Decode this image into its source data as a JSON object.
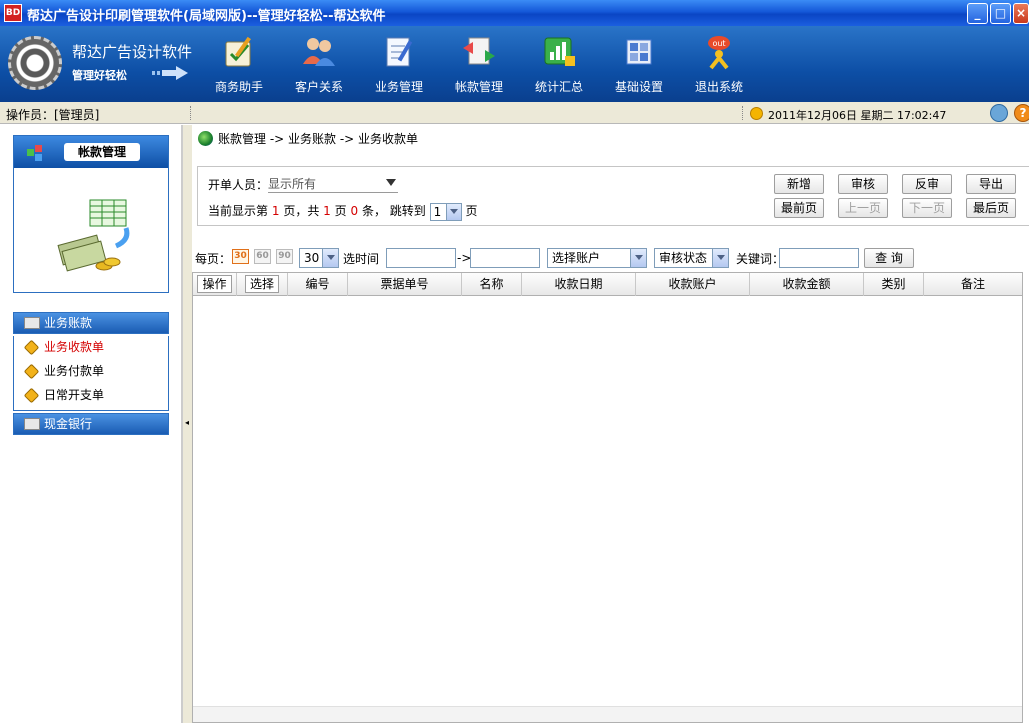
{
  "window": {
    "title": "帮达广告设计印刷管理软件(局域网版)--管理好轻松--帮达软件",
    "icon_label": "BD",
    "minimize_label": "_",
    "maximize_label": "□",
    "close_label": "×"
  },
  "logo": {
    "title": "帮达广告设计软件",
    "subtitle": "管理好轻松"
  },
  "toolbar": [
    {
      "label": "商务助手",
      "icon": "clipboard-check-icon",
      "color": "#f0c040"
    },
    {
      "label": "客户关系",
      "icon": "users-icon",
      "color": "#e86a4a"
    },
    {
      "label": "业务管理",
      "icon": "edit-document-icon",
      "color": "#5a9ee0"
    },
    {
      "label": "帐款管理",
      "icon": "transfer-icon",
      "color": "#e84a4a"
    },
    {
      "label": "统计汇总",
      "icon": "chart-icon",
      "color": "#3ab04a"
    },
    {
      "label": "基础设置",
      "icon": "settings-grid-icon",
      "color": "#4a7ad0"
    },
    {
      "label": "退出系统",
      "icon": "exit-icon",
      "color": "#f0a020"
    }
  ],
  "status": {
    "operator": "操作员：[管理员]",
    "datetime": "2011年12月06日  星期二  17:02:47",
    "help_label": "?"
  },
  "sidebar": {
    "module_title": "帐款管理",
    "groups": [
      {
        "label": "业务账款",
        "items": [
          {
            "label": "业务收款单",
            "active": true
          },
          {
            "label": "业务付款单",
            "active": false
          },
          {
            "label": "日常开支单",
            "active": false
          }
        ]
      },
      {
        "label": "现金银行",
        "items": []
      }
    ],
    "collapse_arrow": "◂"
  },
  "breadcrumb": "账款管理 -> 业务账款 -> 业务收款单",
  "filter": {
    "creator_label": "开单人员：",
    "creator_value": "显示所有",
    "page_info": {
      "prefix": "当前显示第",
      "current_page": "1",
      "mid1": "页，共",
      "total_pages": "1",
      "mid2": "页",
      "count": "0",
      "suffix": "条，",
      "jump_label": "跳转到",
      "jump_value": "1",
      "jump_suffix": "页"
    },
    "buttons": {
      "add": "新增",
      "audit": "审核",
      "unaudit": "反审",
      "export": "导出",
      "first": "最前页",
      "prev": "上一页",
      "next": "下一页",
      "last": "最后页"
    }
  },
  "search": {
    "per_page_label": "每页：",
    "per_page_options": [
      "30",
      "60",
      "90"
    ],
    "per_page_selected": "30",
    "time_label": "选时间",
    "time_from": "",
    "time_sep": "->",
    "time_to": "",
    "account_select": "选择账户",
    "status_select": "审核状态",
    "keyword_label": "关键词：",
    "keyword_value": "",
    "query_button": "查 询"
  },
  "table": {
    "columns": [
      "操作",
      "选择",
      "编号",
      "票据单号",
      "名称",
      "收款日期",
      "收款账户",
      "收款金额",
      "类别",
      "备注"
    ],
    "rows": []
  }
}
